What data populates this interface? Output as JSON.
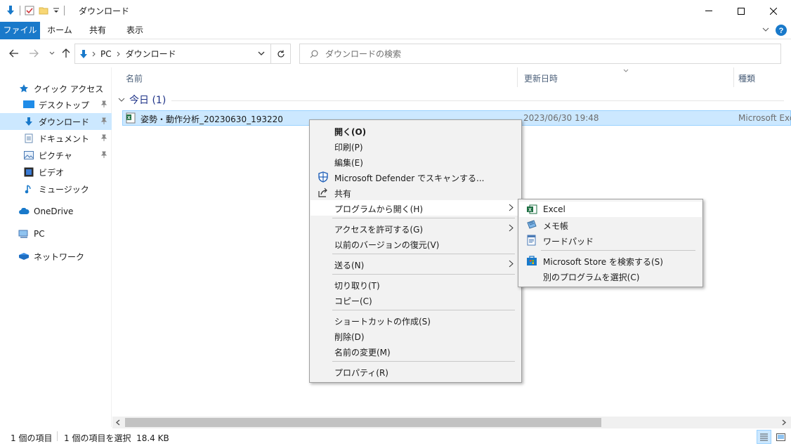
{
  "window": {
    "title": "ダウンロード",
    "minimize": "minimize",
    "maximize": "maximize",
    "close": "close"
  },
  "ribbon": {
    "tabs": [
      {
        "label": "ファイル"
      },
      {
        "label": "ホーム"
      },
      {
        "label": "共有"
      },
      {
        "label": "表示"
      }
    ]
  },
  "address": {
    "crumbs": [
      "PC",
      "ダウンロード"
    ],
    "search_placeholder": "ダウンロードの検索"
  },
  "nav": {
    "quick_access": "クイック アクセス",
    "items": [
      {
        "label": "デスクトップ"
      },
      {
        "label": "ダウンロード"
      },
      {
        "label": "ドキュメント"
      },
      {
        "label": "ピクチャ"
      },
      {
        "label": "ビデオ"
      },
      {
        "label": "ミュージック"
      }
    ],
    "onedrive": "OneDrive",
    "pc": "PC",
    "network": "ネットワーク"
  },
  "columns": {
    "name": "名前",
    "date": "更新日時",
    "type": "種類"
  },
  "group": {
    "label": "今日 (1)"
  },
  "file": {
    "name": "姿勢・動作分析_20230630_193220",
    "date": "2023/06/30 19:48",
    "type": "Microsoft Excel"
  },
  "context_menu": {
    "open": "開く(O)",
    "print": "印刷(P)",
    "edit": "編集(E)",
    "defender": "Microsoft Defender でスキャンする...",
    "share": "共有",
    "open_with": "プログラムから開く(H)",
    "grant_access": "アクセスを許可する(G)",
    "restore": "以前のバージョンの復元(V)",
    "send_to": "送る(N)",
    "cut": "切り取り(T)",
    "copy": "コピー(C)",
    "shortcut": "ショートカットの作成(S)",
    "delete": "削除(D)",
    "rename": "名前の変更(M)",
    "properties": "プロパティ(R)"
  },
  "submenu": {
    "excel": "Excel",
    "notepad": "メモ帳",
    "wordpad": "ワードパッド",
    "store": "Microsoft Store を検索する(S)",
    "other": "別のプログラムを選択(C)"
  },
  "status": {
    "count": "1 個の項目",
    "selected": "1 個の項目を選択  18.4 KB"
  },
  "colors": {
    "accent": "#1979ca",
    "selection": "#cce8ff",
    "group_text": "#1e3287",
    "excel_green": "#1d6f42"
  }
}
